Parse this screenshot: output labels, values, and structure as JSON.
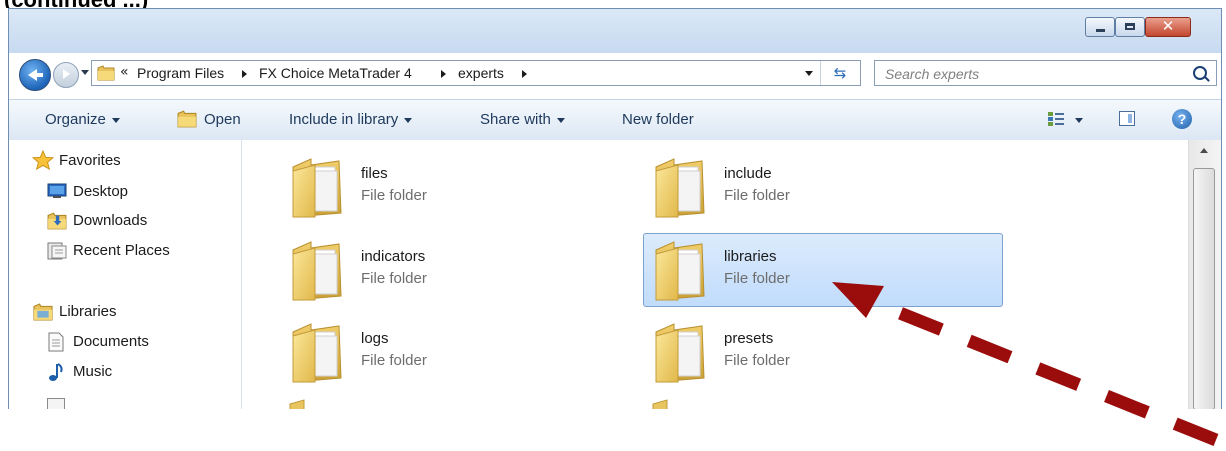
{
  "address": {
    "overflow": "«",
    "crumbs": [
      "Program Files",
      "FX Choice MetaTrader 4",
      "experts"
    ]
  },
  "search": {
    "placeholder": "Search experts"
  },
  "toolbar": {
    "organize": "Organize",
    "open": "Open",
    "include_in_library": "Include in library",
    "share_with": "Share with",
    "new_folder": "New folder"
  },
  "nav": {
    "favorites": "Favorites",
    "desktop": "Desktop",
    "downloads": "Downloads",
    "recent_places": "Recent Places",
    "libraries": "Libraries",
    "documents": "Documents",
    "music": "Music"
  },
  "folders": [
    {
      "name": "files",
      "type": "File folder"
    },
    {
      "name": "include",
      "type": "File folder"
    },
    {
      "name": "indicators",
      "type": "File folder"
    },
    {
      "name": "libraries",
      "type": "File folder",
      "selected": true
    },
    {
      "name": "logs",
      "type": "File folder"
    },
    {
      "name": "presets",
      "type": "File folder"
    }
  ],
  "colors": {
    "selection": "#c1dcfc",
    "annotation_arrow": "#9b0d0d"
  },
  "icons": [
    "back-arrow-icon",
    "forward-arrow-icon",
    "folder-icon",
    "refresh-icon",
    "search-icon",
    "views-icon",
    "preview-pane-icon",
    "help-icon",
    "star-icon",
    "desktop-icon",
    "downloads-icon",
    "recent-places-icon",
    "libraries-icon",
    "documents-icon",
    "music-icon"
  ]
}
